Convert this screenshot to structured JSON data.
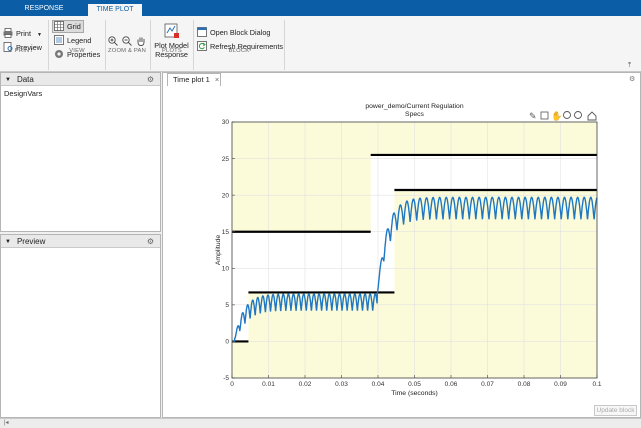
{
  "tabs": [
    {
      "label": "RESPONSE OPTIMIZATION"
    },
    {
      "label": "TIME PLOT"
    }
  ],
  "ribbon": {
    "print": "Print",
    "preview": "Preview",
    "grid": "Grid",
    "legend": "Legend",
    "properties": "Properties",
    "plot_model_response": [
      "Plot Model",
      "Response"
    ],
    "open_block_dialog": "Open Block Dialog",
    "refresh_requirements": "Refresh Requirements",
    "groups": {
      "print": "PRINT",
      "view": "VIEW",
      "zoom_pan": "ZOOM & PAN",
      "plots": "PLOTS",
      "block": "BLOCK"
    }
  },
  "data_panel": {
    "title": "Data",
    "items": [
      "DesignVars"
    ]
  },
  "preview_panel": {
    "title": "Preview"
  },
  "document_tab": "Time plot 1",
  "update_block": "Update block",
  "colors": {
    "accent": "#0b5ea5",
    "signal": "#1f77c4",
    "bound_fill": "#fbfbd9",
    "bound_line": "#000000"
  },
  "chart_data": {
    "type": "line",
    "title": [
      "power_demo/Current  Regulation",
      "Specs"
    ],
    "xlabel": "Time (seconds)",
    "ylabel": "Amplitude",
    "xlim": [
      0,
      0.1
    ],
    "ylim": [
      -5,
      30
    ],
    "xticks": [
      "0",
      "0.01",
      "0.02",
      "0.03",
      "0.04",
      "0.05",
      "0.06",
      "0.07",
      "0.08",
      "0.09",
      "0.1"
    ],
    "yticks": [
      "-5",
      "0",
      "5",
      "10",
      "15",
      "20",
      "25",
      "30"
    ],
    "grid": true,
    "upper_bound": [
      {
        "x": [
          0,
          0.038
        ],
        "y": [
          15,
          15
        ]
      },
      {
        "x": [
          0.038,
          0.1
        ],
        "y": [
          25.5,
          25.5
        ]
      }
    ],
    "lower_bound": [
      {
        "x": [
          0,
          0.0045
        ],
        "y": [
          0,
          0
        ]
      },
      {
        "x": [
          0.0045,
          0.0445
        ],
        "y": [
          6.7,
          6.7
        ]
      },
      {
        "x": [
          0.0445,
          0.1
        ],
        "y": [
          20.7,
          20.7
        ]
      }
    ],
    "series": [
      {
        "values_note": "",
        "segments": [
          {
            "t0": 0,
            "t1": 0.00075,
            "base": 0,
            "level": 0,
            "ripple": 0
          },
          {
            "t0": 0.00075,
            "t1": 0.0398,
            "base": 0.4,
            "level": 6.5,
            "ripple": 2.3,
            "period": 0.0014
          },
          {
            "t0": 0.0398,
            "t1": 0.1,
            "base": 6.5,
            "level": 19.7,
            "ripple": 3.0,
            "period": 0.0018
          }
        ]
      }
    ]
  }
}
